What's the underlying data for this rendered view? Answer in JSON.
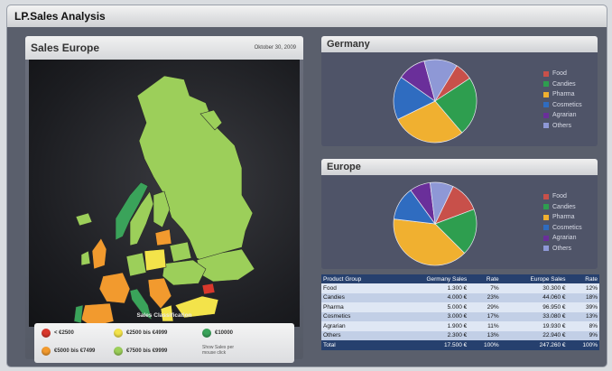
{
  "app": {
    "title": "LP.Sales Analysis"
  },
  "left_panel": {
    "title": "Sales Europe",
    "date": "Oktober 30, 2009"
  },
  "map": {
    "legend_title": "Sales Classification",
    "legend": [
      {
        "label": "< €2500",
        "color": "#d9382c"
      },
      {
        "label": "€2500 bis €4999",
        "color": "#f3e34a"
      },
      {
        "label": "€10000",
        "color": "#3aa35a"
      },
      {
        "label": "€5000 bis €7499",
        "color": "#f29a2e"
      },
      {
        "label": "€7500 bis €9999",
        "color": "#9ccf5a"
      }
    ],
    "note": "Show Sales per\nmouse click"
  },
  "germany": {
    "title": "Germany"
  },
  "europe": {
    "title": "Europe"
  },
  "categories": [
    {
      "label": "Food",
      "color": "#c8504a"
    },
    {
      "label": "Candies",
      "color": "#2e9e4f"
    },
    {
      "label": "Pharma",
      "color": "#f0b030"
    },
    {
      "label": "Cosmetics",
      "color": "#2f6cc0"
    },
    {
      "label": "Agrarian",
      "color": "#6a2f9a"
    },
    {
      "label": "Others",
      "color": "#8e98d6"
    }
  ],
  "chart_data": [
    {
      "type": "pie",
      "title": "Germany",
      "labels": [
        "Food",
        "Candies",
        "Pharma",
        "Cosmetics",
        "Agrarian",
        "Others"
      ],
      "values": [
        7,
        23,
        29,
        17,
        11,
        13
      ]
    },
    {
      "type": "pie",
      "title": "Europe",
      "labels": [
        "Food",
        "Candies",
        "Pharma",
        "Cosmetics",
        "Agrarian",
        "Others"
      ],
      "values": [
        12,
        18,
        39,
        13,
        8,
        9
      ]
    }
  ],
  "table": {
    "headers": [
      "Product Group",
      "Germany Sales",
      "Rate",
      "Europe Sales",
      "Rate"
    ],
    "rows": [
      [
        "Food",
        "1.300 €",
        "7%",
        "30.300 €",
        "12%"
      ],
      [
        "Candies",
        "4.000 €",
        "23%",
        "44.060 €",
        "18%"
      ],
      [
        "Pharma",
        "5.000 €",
        "29%",
        "96.950 €",
        "39%"
      ],
      [
        "Cosmetics",
        "3.000 €",
        "17%",
        "33.080 €",
        "13%"
      ],
      [
        "Agrarian",
        "1.900 €",
        "11%",
        "19.930 €",
        "8%"
      ],
      [
        "Others",
        "2.300 €",
        "13%",
        "22.940 €",
        "9%"
      ]
    ],
    "total": [
      "Total",
      "17.500 €",
      "100%",
      "247.260 €",
      "100%"
    ]
  }
}
